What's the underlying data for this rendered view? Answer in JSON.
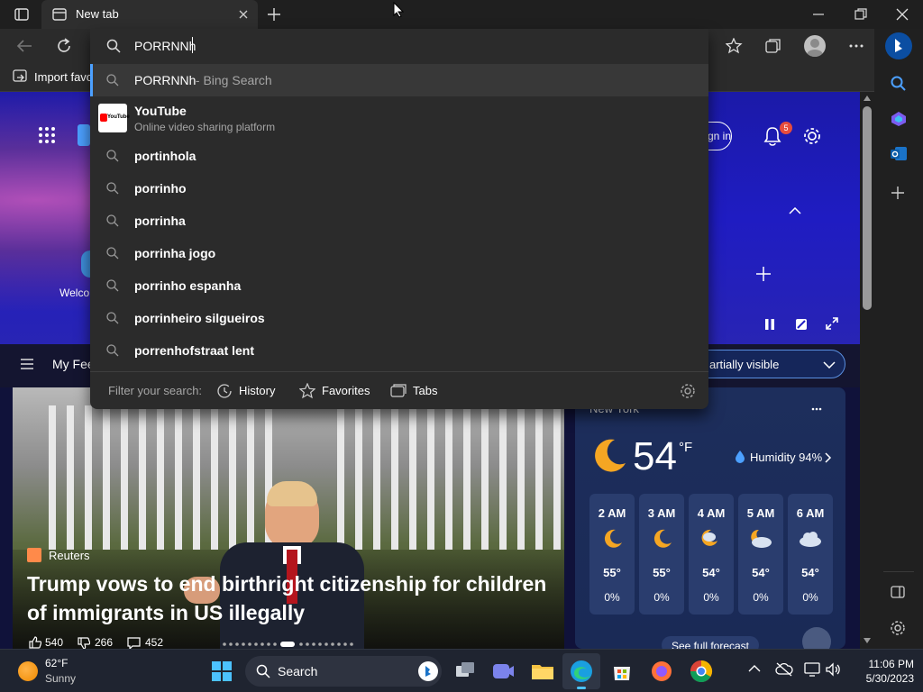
{
  "browser": {
    "tab_title": "New tab",
    "address_query": "PORRNNh",
    "favbar_import": "Import favo"
  },
  "suggestions": {
    "bing": {
      "query": "PORRNNh",
      "suffix": " - Bing Search"
    },
    "youtube": {
      "title": "YouTube",
      "subtitle": "Online video sharing platform",
      "logo_text": "YouTube"
    },
    "items": [
      "portinhola",
      "porrinho",
      "porrinha",
      "porrinha jogo",
      "porrinho espanha",
      "porrinheiro silgueiros",
      "porrenhofstraat lent"
    ]
  },
  "filter": {
    "label": "Filter your search:",
    "history": "History",
    "favorites": "Favorites",
    "tabs": "Tabs"
  },
  "page": {
    "sign_in": "gn in",
    "notification_count": "5",
    "welcome": "Welco",
    "my_feed": "My Fee",
    "visibility": "artially visible",
    "news": {
      "source": "Reuters",
      "headline": "Trump vows to end birthright citizenship for children of immigrants in US illegally",
      "likes": "540",
      "dislikes": "266",
      "comments": "452"
    },
    "weather": {
      "city": "New York",
      "temp": "54",
      "unit": "°F",
      "humidity": "Humidity 94%",
      "forecast_link": "See full forecast",
      "hours": [
        {
          "time": "2 AM",
          "temp": "55°",
          "precip": "0%",
          "icon": "moon-icon"
        },
        {
          "time": "3 AM",
          "temp": "55°",
          "precip": "0%",
          "icon": "moon-icon"
        },
        {
          "time": "4 AM",
          "temp": "54°",
          "precip": "0%",
          "icon": "moon-cloud-icon"
        },
        {
          "time": "5 AM",
          "temp": "54°",
          "precip": "0%",
          "icon": "moon-cloud-icon"
        },
        {
          "time": "6 AM",
          "temp": "54°",
          "precip": "0%",
          "icon": "cloud-icon"
        }
      ]
    }
  },
  "taskbar": {
    "weather_temp": "62°F",
    "weather_desc": "Sunny",
    "search_label": "Search",
    "time": "11:06 PM",
    "date": "5/30/2023"
  },
  "colors": {
    "accent": "#4ca0ff",
    "notification": "#e74c3c",
    "moon": "#f5a623"
  }
}
